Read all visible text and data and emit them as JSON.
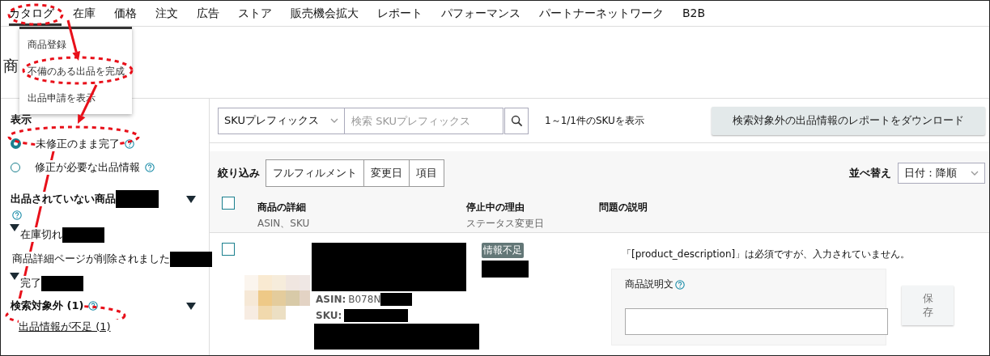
{
  "nav": {
    "items": [
      {
        "label": "カタログ",
        "selected": true
      },
      {
        "label": "在庫",
        "selected": false
      },
      {
        "label": "価格",
        "selected": false
      },
      {
        "label": "注文",
        "selected": false
      },
      {
        "label": "広告",
        "selected": false
      },
      {
        "label": "ストア",
        "selected": false
      },
      {
        "label": "販売機会拡大",
        "selected": false
      },
      {
        "label": "レポート",
        "selected": false
      },
      {
        "label": "パフォーマンス",
        "selected": false
      },
      {
        "label": "パートナーネットワーク",
        "selected": false
      },
      {
        "label": "B2B",
        "selected": false
      }
    ]
  },
  "menu": {
    "items": [
      "商品登録",
      "不備のある出品を完成",
      "出品申請を表示"
    ]
  },
  "page_title": "商",
  "sidebar": {
    "heading": "表示",
    "options": [
      {
        "label": "未修正のまま完了",
        "selected": true
      },
      {
        "label": "修正が必要な出品情報",
        "selected": false
      }
    ],
    "sections": [
      {
        "title": "出品されていない商品",
        "redacted": true,
        "items": [
          {
            "label": "在庫切れ",
            "caret": true,
            "redacted": true
          },
          {
            "label": "商品詳細ページが削除されました",
            "caret": false,
            "redacted": true
          },
          {
            "label": "完了",
            "caret": true,
            "redacted": true
          }
        ]
      },
      {
        "title": "検索対象外 (1)",
        "redacted": false,
        "links": [
          "出品情報が不足 (1)"
        ]
      }
    ]
  },
  "toolbar": {
    "search_scope": "SKUプレフィックス",
    "search_placeholder": "検索 SKUプレフィックス",
    "result_count": "1～1/1件のSKUを表示",
    "download_button": "検索対象外の出品情報のレポートをダウンロード"
  },
  "filter": {
    "label": "絞り込み",
    "buttons": [
      "フルフィルメント",
      "変更日",
      "項目"
    ]
  },
  "sort": {
    "label": "並べ替え",
    "value": "日付：降順"
  },
  "table": {
    "select_all": {
      "checked": false
    },
    "columns": [
      {
        "title": "商品の詳細",
        "subtitle": "ASIN、SKU"
      },
      {
        "title": "停止中の理由",
        "subtitle": "ステータス変更日"
      },
      {
        "title": "問題の説明"
      }
    ],
    "rows": [
      {
        "checked": false,
        "asin_label": "ASIN:",
        "asin": "B078N",
        "sku_label": "SKU:",
        "status": "情報不足",
        "issue": "「[product_description]」は必須ですが、入力されていません。",
        "field_label": "商品説明文",
        "save_button": "保存"
      }
    ]
  }
}
